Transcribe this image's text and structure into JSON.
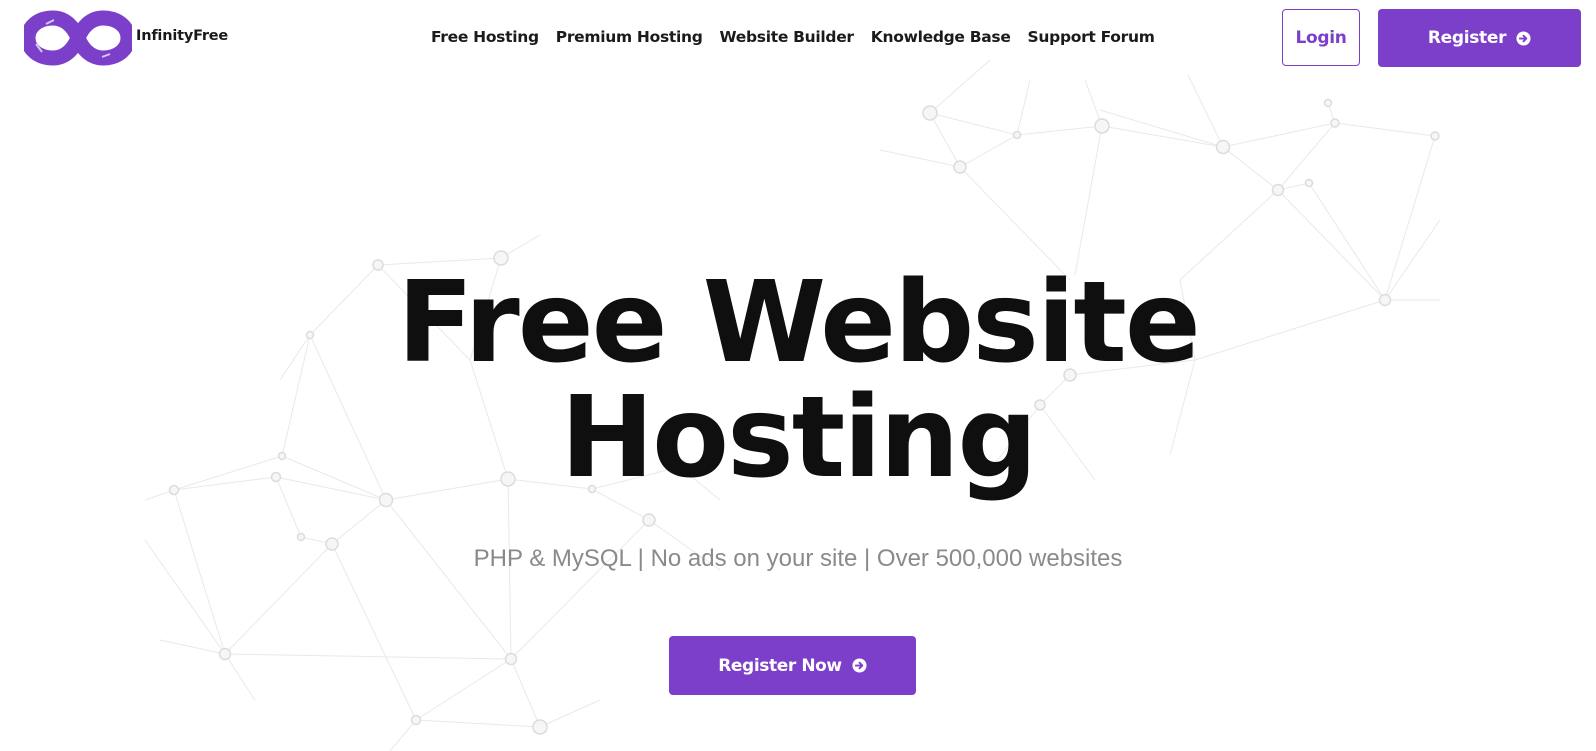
{
  "brand": {
    "name": "InfinityFree",
    "accent_color": "#7b3fc9"
  },
  "nav": {
    "items": [
      {
        "label": "Free Hosting"
      },
      {
        "label": "Premium Hosting"
      },
      {
        "label": "Website Builder"
      },
      {
        "label": "Knowledge Base"
      },
      {
        "label": "Support Forum"
      }
    ]
  },
  "header_actions": {
    "login_label": "Login",
    "register_label": "Register",
    "register_icon": "arrow-right-circle-icon"
  },
  "hero": {
    "title_line1": "Free Website",
    "title_line2": "Hosting",
    "subtitle": "PHP & MySQL | No ads on your site | Over 500,000 websites",
    "cta_label": "Register Now",
    "cta_icon": "arrow-right-circle-icon"
  },
  "background": {
    "decoration": "network-nodes-pattern"
  }
}
